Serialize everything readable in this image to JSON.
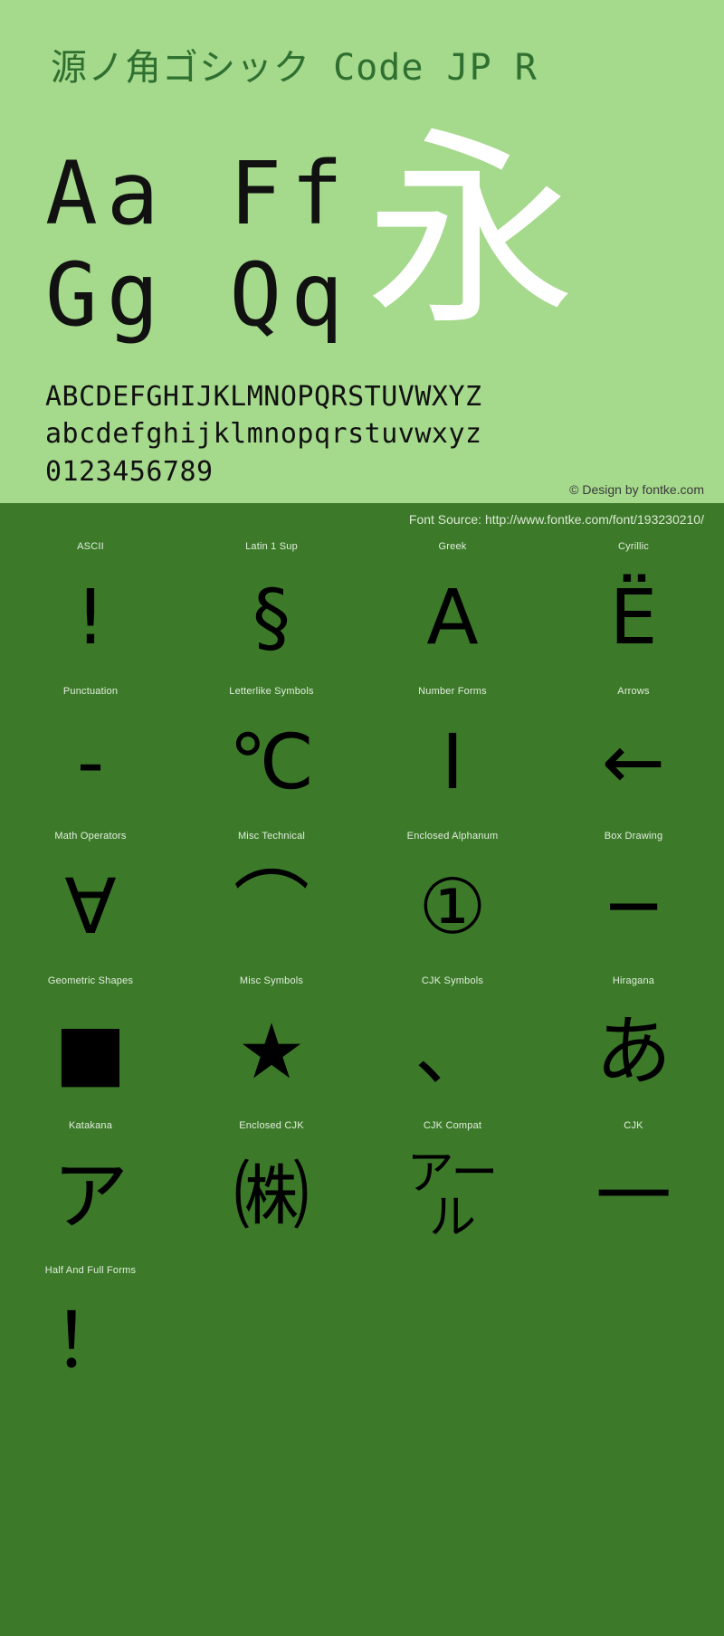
{
  "specimen": {
    "title": "源ノ角ゴシック Code JP R",
    "sample_big_line1": "Aa  Ff",
    "sample_big_line2": "Gg  Qq",
    "sample_cjk": "永",
    "alphabet_upper": "ABCDEFGHIJKLMNOPQRSTUVWXYZ",
    "alphabet_lower": "abcdefghijklmnopqrstuvwxyz",
    "digits": "0123456789",
    "credit": "© Design by fontke.com",
    "font_source": "Font Source: http://www.fontke.com/font/193230210/",
    "colors": {
      "top_background": "#a5d98c",
      "bottom_background": "#3c7a2a",
      "title_color": "#2f7030",
      "glyph_color": "#000000",
      "cjk_sample_color": "#ffffff",
      "label_color": "#e2eedd"
    }
  },
  "glyph_grid": {
    "rows": [
      {
        "cells": [
          {
            "label": "ASCII",
            "char": "!",
            "size": "normal"
          },
          {
            "label": "Latin 1 Sup",
            "char": "§",
            "size": "normal"
          },
          {
            "label": "Greek",
            "char": "Α",
            "size": "normal"
          },
          {
            "label": "Cyrillic",
            "char": "Ё",
            "size": "normal"
          }
        ]
      },
      {
        "cells": [
          {
            "label": "Punctuation",
            "char": "‐",
            "size": "normal"
          },
          {
            "label": "Letterlike Symbols",
            "char": "℃",
            "size": "normal"
          },
          {
            "label": "Number Forms",
            "char": "Ⅰ",
            "size": "normal"
          },
          {
            "label": "Arrows",
            "char": "←",
            "size": "normal"
          }
        ]
      },
      {
        "cells": [
          {
            "label": "Math Operators",
            "char": "∀",
            "size": "normal"
          },
          {
            "label": "Misc Technical",
            "char": "⌒",
            "size": "normal"
          },
          {
            "label": "Enclosed Alphanum",
            "char": "①",
            "size": "normal"
          },
          {
            "label": "Box Drawing",
            "char": "─",
            "size": "normal"
          }
        ]
      },
      {
        "cells": [
          {
            "label": "Geometric Shapes",
            "char": "■",
            "size": "normal"
          },
          {
            "label": "Misc Symbols",
            "char": "★",
            "size": "normal"
          },
          {
            "label": "CJK Symbols",
            "char": "、",
            "size": "normal"
          },
          {
            "label": "Hiragana",
            "char": "あ",
            "size": "normal"
          }
        ]
      },
      {
        "cells": [
          {
            "label": "Katakana",
            "char": "ア",
            "size": "normal"
          },
          {
            "label": "Enclosed CJK",
            "char": "㈱",
            "size": "normal"
          },
          {
            "label": "CJK Compat",
            "char": "アール",
            "size": "wrap2"
          },
          {
            "label": "CJK",
            "char": "一",
            "size": "normal"
          }
        ]
      },
      {
        "cells": [
          {
            "label": "Half And Full Forms",
            "char": "！",
            "size": "normal"
          },
          {
            "label": "",
            "char": "",
            "size": "normal"
          },
          {
            "label": "",
            "char": "",
            "size": "normal"
          },
          {
            "label": "",
            "char": "",
            "size": "normal"
          }
        ]
      }
    ]
  }
}
